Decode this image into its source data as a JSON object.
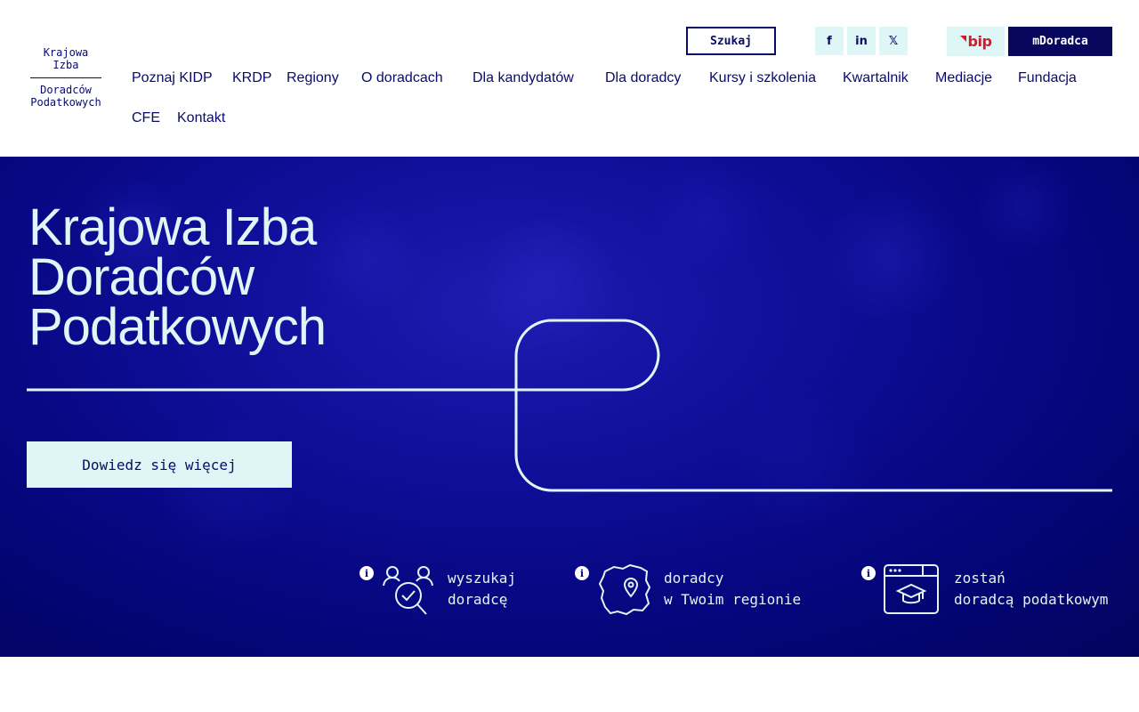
{
  "logo": {
    "line1": "Krajowa",
    "line2": "Izba",
    "line3": "Doradców",
    "line4": "Podatkowych"
  },
  "top_actions": {
    "search_label": "Szukaj",
    "social": [
      {
        "icon": "facebook-icon",
        "glyph": "f"
      },
      {
        "icon": "linkedin-icon",
        "glyph": "in"
      },
      {
        "icon": "x-icon",
        "glyph": "𝕏"
      }
    ],
    "bip_label": "bip",
    "mdoradca_label": "mDoradca"
  },
  "nav": {
    "items": [
      "Poznaj KIDP",
      "KRDP",
      "Regiony",
      "O doradcach",
      "Dla kandydatów",
      "Dla doradcy",
      "Kursy i szkolenia",
      "Kwartalnik",
      "Mediacje",
      "Fundacja",
      "CFE",
      "Kontakt"
    ]
  },
  "hero": {
    "title_line1": "Krajowa Izba",
    "title_line2": "Doradców",
    "title_line3": "Podatkowych",
    "cta_label": "Dowiedz się więcej"
  },
  "features": [
    {
      "icon": "find-advisor-icon",
      "info": "i",
      "line1": "wyszukaj",
      "line2": "doradcę"
    },
    {
      "icon": "poland-map-icon",
      "info": "i",
      "line1": "doradcy",
      "line2": "w Twoim regionie"
    },
    {
      "icon": "graduation-browser-icon",
      "info": "i",
      "line1": "zostań",
      "line2": "doradcą podatkowym"
    }
  ],
  "colors": {
    "navy": "#0a0a6b",
    "hero_blue": "#0e0e98",
    "light_cyan": "#dff6f6",
    "bip_red": "#d11a2a"
  }
}
